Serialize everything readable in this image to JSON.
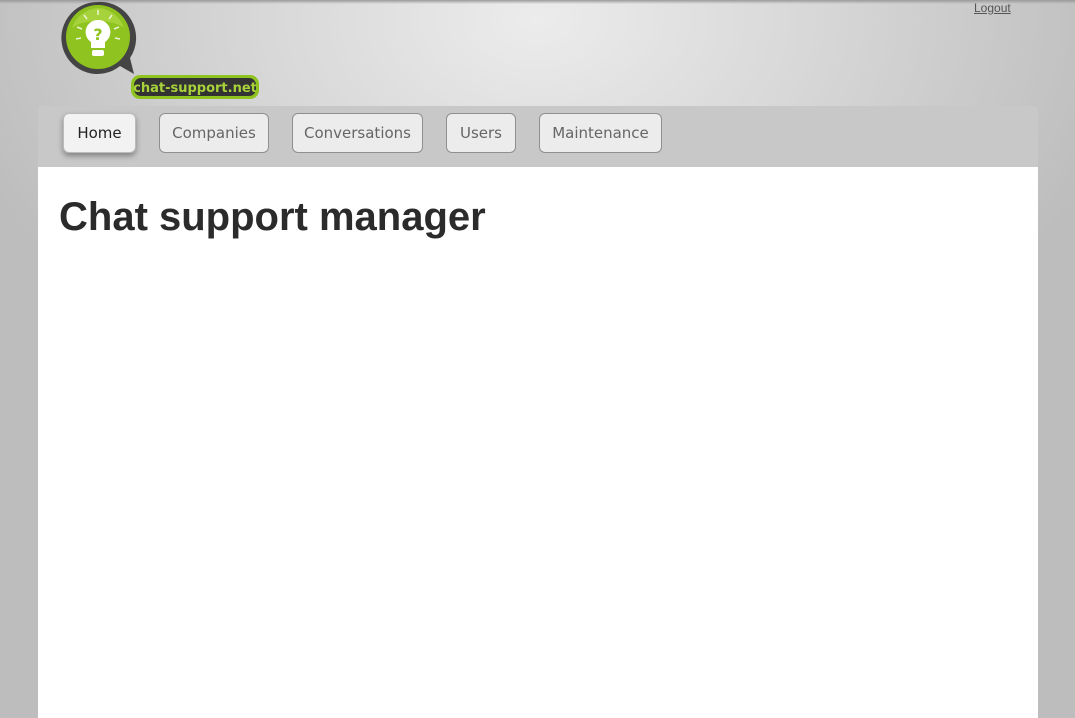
{
  "header": {
    "logout_label": "Logout",
    "logo_text": "chat-support.net"
  },
  "nav": {
    "tabs": [
      {
        "label": "Home",
        "active": true
      },
      {
        "label": "Companies"
      },
      {
        "label": "Conversations"
      },
      {
        "label": "Users"
      },
      {
        "label": "Maintenance"
      }
    ]
  },
  "main": {
    "title": "Chat support manager"
  },
  "colors": {
    "brand_green": "#8fc31f"
  }
}
